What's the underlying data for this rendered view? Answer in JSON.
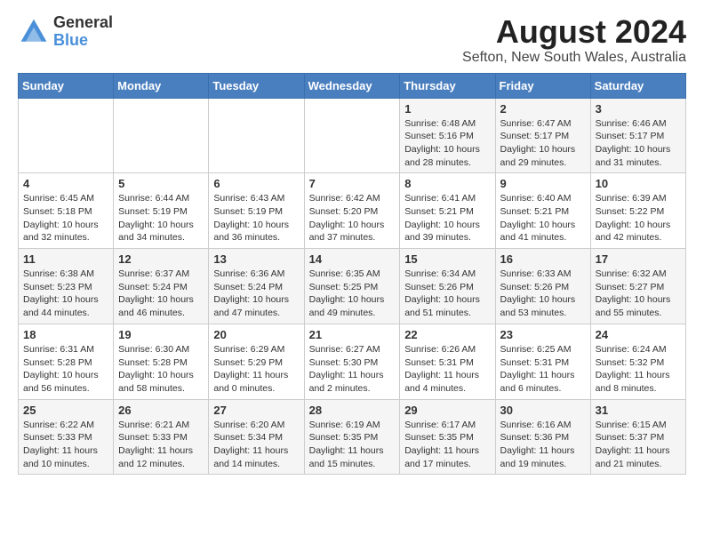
{
  "header": {
    "logo_general": "General",
    "logo_blue": "Blue",
    "title": "August 2024",
    "subtitle": "Sefton, New South Wales, Australia"
  },
  "weekdays": [
    "Sunday",
    "Monday",
    "Tuesday",
    "Wednesday",
    "Thursday",
    "Friday",
    "Saturday"
  ],
  "weeks": [
    [
      {
        "day": "",
        "sunrise": "",
        "sunset": "",
        "daylight": ""
      },
      {
        "day": "",
        "sunrise": "",
        "sunset": "",
        "daylight": ""
      },
      {
        "day": "",
        "sunrise": "",
        "sunset": "",
        "daylight": ""
      },
      {
        "day": "",
        "sunrise": "",
        "sunset": "",
        "daylight": ""
      },
      {
        "day": "1",
        "sunrise": "Sunrise: 6:48 AM",
        "sunset": "Sunset: 5:16 PM",
        "daylight": "Daylight: 10 hours and 28 minutes."
      },
      {
        "day": "2",
        "sunrise": "Sunrise: 6:47 AM",
        "sunset": "Sunset: 5:17 PM",
        "daylight": "Daylight: 10 hours and 29 minutes."
      },
      {
        "day": "3",
        "sunrise": "Sunrise: 6:46 AM",
        "sunset": "Sunset: 5:17 PM",
        "daylight": "Daylight: 10 hours and 31 minutes."
      }
    ],
    [
      {
        "day": "4",
        "sunrise": "Sunrise: 6:45 AM",
        "sunset": "Sunset: 5:18 PM",
        "daylight": "Daylight: 10 hours and 32 minutes."
      },
      {
        "day": "5",
        "sunrise": "Sunrise: 6:44 AM",
        "sunset": "Sunset: 5:19 PM",
        "daylight": "Daylight: 10 hours and 34 minutes."
      },
      {
        "day": "6",
        "sunrise": "Sunrise: 6:43 AM",
        "sunset": "Sunset: 5:19 PM",
        "daylight": "Daylight: 10 hours and 36 minutes."
      },
      {
        "day": "7",
        "sunrise": "Sunrise: 6:42 AM",
        "sunset": "Sunset: 5:20 PM",
        "daylight": "Daylight: 10 hours and 37 minutes."
      },
      {
        "day": "8",
        "sunrise": "Sunrise: 6:41 AM",
        "sunset": "Sunset: 5:21 PM",
        "daylight": "Daylight: 10 hours and 39 minutes."
      },
      {
        "day": "9",
        "sunrise": "Sunrise: 6:40 AM",
        "sunset": "Sunset: 5:21 PM",
        "daylight": "Daylight: 10 hours and 41 minutes."
      },
      {
        "day": "10",
        "sunrise": "Sunrise: 6:39 AM",
        "sunset": "Sunset: 5:22 PM",
        "daylight": "Daylight: 10 hours and 42 minutes."
      }
    ],
    [
      {
        "day": "11",
        "sunrise": "Sunrise: 6:38 AM",
        "sunset": "Sunset: 5:23 PM",
        "daylight": "Daylight: 10 hours and 44 minutes."
      },
      {
        "day": "12",
        "sunrise": "Sunrise: 6:37 AM",
        "sunset": "Sunset: 5:24 PM",
        "daylight": "Daylight: 10 hours and 46 minutes."
      },
      {
        "day": "13",
        "sunrise": "Sunrise: 6:36 AM",
        "sunset": "Sunset: 5:24 PM",
        "daylight": "Daylight: 10 hours and 47 minutes."
      },
      {
        "day": "14",
        "sunrise": "Sunrise: 6:35 AM",
        "sunset": "Sunset: 5:25 PM",
        "daylight": "Daylight: 10 hours and 49 minutes."
      },
      {
        "day": "15",
        "sunrise": "Sunrise: 6:34 AM",
        "sunset": "Sunset: 5:26 PM",
        "daylight": "Daylight: 10 hours and 51 minutes."
      },
      {
        "day": "16",
        "sunrise": "Sunrise: 6:33 AM",
        "sunset": "Sunset: 5:26 PM",
        "daylight": "Daylight: 10 hours and 53 minutes."
      },
      {
        "day": "17",
        "sunrise": "Sunrise: 6:32 AM",
        "sunset": "Sunset: 5:27 PM",
        "daylight": "Daylight: 10 hours and 55 minutes."
      }
    ],
    [
      {
        "day": "18",
        "sunrise": "Sunrise: 6:31 AM",
        "sunset": "Sunset: 5:28 PM",
        "daylight": "Daylight: 10 hours and 56 minutes."
      },
      {
        "day": "19",
        "sunrise": "Sunrise: 6:30 AM",
        "sunset": "Sunset: 5:28 PM",
        "daylight": "Daylight: 10 hours and 58 minutes."
      },
      {
        "day": "20",
        "sunrise": "Sunrise: 6:29 AM",
        "sunset": "Sunset: 5:29 PM",
        "daylight": "Daylight: 11 hours and 0 minutes."
      },
      {
        "day": "21",
        "sunrise": "Sunrise: 6:27 AM",
        "sunset": "Sunset: 5:30 PM",
        "daylight": "Daylight: 11 hours and 2 minutes."
      },
      {
        "day": "22",
        "sunrise": "Sunrise: 6:26 AM",
        "sunset": "Sunset: 5:31 PM",
        "daylight": "Daylight: 11 hours and 4 minutes."
      },
      {
        "day": "23",
        "sunrise": "Sunrise: 6:25 AM",
        "sunset": "Sunset: 5:31 PM",
        "daylight": "Daylight: 11 hours and 6 minutes."
      },
      {
        "day": "24",
        "sunrise": "Sunrise: 6:24 AM",
        "sunset": "Sunset: 5:32 PM",
        "daylight": "Daylight: 11 hours and 8 minutes."
      }
    ],
    [
      {
        "day": "25",
        "sunrise": "Sunrise: 6:22 AM",
        "sunset": "Sunset: 5:33 PM",
        "daylight": "Daylight: 11 hours and 10 minutes."
      },
      {
        "day": "26",
        "sunrise": "Sunrise: 6:21 AM",
        "sunset": "Sunset: 5:33 PM",
        "daylight": "Daylight: 11 hours and 12 minutes."
      },
      {
        "day": "27",
        "sunrise": "Sunrise: 6:20 AM",
        "sunset": "Sunset: 5:34 PM",
        "daylight": "Daylight: 11 hours and 14 minutes."
      },
      {
        "day": "28",
        "sunrise": "Sunrise: 6:19 AM",
        "sunset": "Sunset: 5:35 PM",
        "daylight": "Daylight: 11 hours and 15 minutes."
      },
      {
        "day": "29",
        "sunrise": "Sunrise: 6:17 AM",
        "sunset": "Sunset: 5:35 PM",
        "daylight": "Daylight: 11 hours and 17 minutes."
      },
      {
        "day": "30",
        "sunrise": "Sunrise: 6:16 AM",
        "sunset": "Sunset: 5:36 PM",
        "daylight": "Daylight: 11 hours and 19 minutes."
      },
      {
        "day": "31",
        "sunrise": "Sunrise: 6:15 AM",
        "sunset": "Sunset: 5:37 PM",
        "daylight": "Daylight: 11 hours and 21 minutes."
      }
    ]
  ]
}
